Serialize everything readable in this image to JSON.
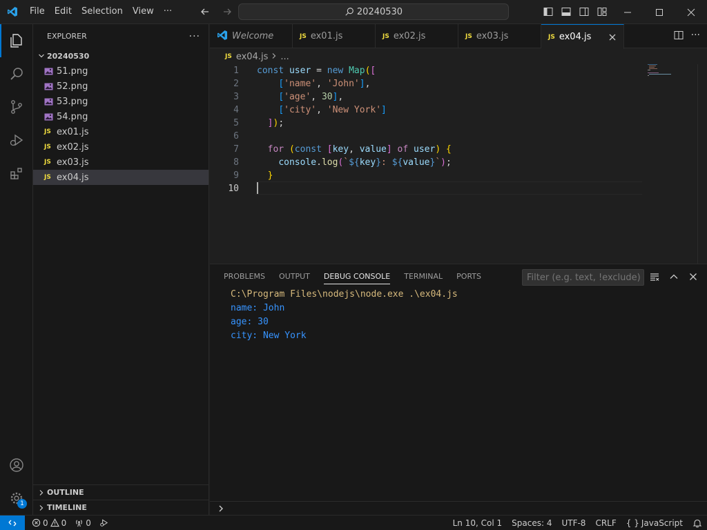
{
  "titlebar": {
    "menu": [
      "File",
      "Edit",
      "Selection",
      "View",
      "···"
    ],
    "search": "20240530"
  },
  "sidebar": {
    "title": "EXPLORER",
    "more": "···",
    "folder": "20240530",
    "files": [
      {
        "name": "51.png",
        "type": "image"
      },
      {
        "name": "52.png",
        "type": "image"
      },
      {
        "name": "53.png",
        "type": "image"
      },
      {
        "name": "54.png",
        "type": "image"
      },
      {
        "name": "ex01.js",
        "type": "js"
      },
      {
        "name": "ex02.js",
        "type": "js"
      },
      {
        "name": "ex03.js",
        "type": "js"
      },
      {
        "name": "ex04.js",
        "type": "js",
        "selected": true
      }
    ],
    "outline": "OUTLINE",
    "timeline": "TIMELINE"
  },
  "tabs": [
    {
      "label": "Welcome",
      "kind": "welcome"
    },
    {
      "label": "ex01.js",
      "kind": "js"
    },
    {
      "label": "ex02.js",
      "kind": "js"
    },
    {
      "label": "ex03.js",
      "kind": "js"
    },
    {
      "label": "ex04.js",
      "kind": "js",
      "active": true
    }
  ],
  "js_badge": "JS",
  "breadcrumb": {
    "file": "ex04.js",
    "sep": ">",
    "rest": "..."
  },
  "editor": {
    "line_numbers": [
      "1",
      "2",
      "3",
      "4",
      "5",
      "6",
      "7",
      "8",
      "9",
      "10"
    ],
    "current_line": "10"
  },
  "panel": {
    "tabs": [
      "PROBLEMS",
      "OUTPUT",
      "DEBUG CONSOLE",
      "TERMINAL",
      "PORTS"
    ],
    "active_tab": "DEBUG CONSOLE",
    "filter_placeholder": "Filter (e.g. text, !exclude)",
    "command": "C:\\Program Files\\nodejs\\node.exe .\\ex04.js",
    "output": [
      "name: John",
      "age: 30",
      "city: New York"
    ]
  },
  "statusbar": {
    "errors": "0",
    "warnings": "0",
    "ports": "0",
    "position": "Ln 10, Col 1",
    "spaces": "Spaces: 4",
    "encoding": "UTF-8",
    "eol": "CRLF",
    "language_icon": "{ }",
    "language": "JavaScript"
  },
  "activity": {
    "settings_badge": "1"
  },
  "colors": {
    "accent": "#0078d4",
    "js": "#f1dd3f"
  }
}
